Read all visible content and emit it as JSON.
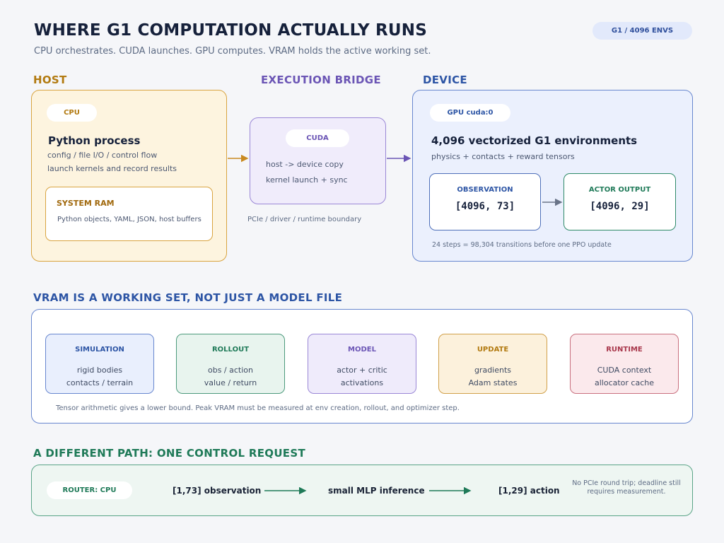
{
  "header": {
    "title": "WHERE G1 COMPUTATION ACTUALLY RUNS",
    "subtitle": "CPU orchestrates. CUDA launches. GPU computes. VRAM holds the active working set.",
    "badge": "G1 / 4096 ENVS"
  },
  "host": {
    "heading": "HOST",
    "pill": "CPU",
    "title": "Python process",
    "line1": "config / file I/O / control flow",
    "line2": "launch kernels and record results",
    "ram": {
      "title": "SYSTEM RAM",
      "text": "Python objects, YAML, JSON, host buffers"
    }
  },
  "bridge": {
    "heading": "EXECUTION BRIDGE",
    "pill": "CUDA",
    "line1": "host -> device copy",
    "line2": "kernel launch + sync",
    "caption": "PCIe / driver / runtime boundary"
  },
  "device": {
    "heading": "DEVICE",
    "pill": "GPU cuda:0",
    "title": "4,096 vectorized G1 environments",
    "subtitle": "physics + contacts + reward tensors",
    "observation": {
      "label": "OBSERVATION",
      "value": "[4096, 73]"
    },
    "actor_output": {
      "label": "ACTOR OUTPUT",
      "value": "[4096, 29]"
    },
    "footer": "24 steps = 98,304 transitions before one PPO update"
  },
  "vram": {
    "heading": "VRAM IS A WORKING SET, NOT JUST A MODEL FILE",
    "cards": [
      {
        "label": "SIMULATION",
        "line1": "rigid bodies",
        "line2": "contacts / terrain"
      },
      {
        "label": "ROLLOUT",
        "line1": "obs / action",
        "line2": "value / return"
      },
      {
        "label": "MODEL",
        "line1": "actor + critic",
        "line2": "activations"
      },
      {
        "label": "UPDATE",
        "line1": "gradients",
        "line2": "Adam states"
      },
      {
        "label": "RUNTIME",
        "line1": "CUDA context",
        "line2": "allocator cache"
      }
    ],
    "footer": "Tensor arithmetic gives a lower bound. Peak VRAM must be measured at env creation, rollout, and optimizer step."
  },
  "path": {
    "heading": "A DIFFERENT PATH: ONE CONTROL REQUEST",
    "pill": "ROUTER: CPU",
    "step1": "[1,73] observation",
    "step2": "small MLP inference",
    "step3": "[1,29] action",
    "note": "No PCIe round trip; deadline still requires measurement."
  },
  "colors": {
    "host": "#d9a440",
    "bridge": "#9a87d6",
    "device": "#6887cf",
    "path": "#5aa487"
  }
}
